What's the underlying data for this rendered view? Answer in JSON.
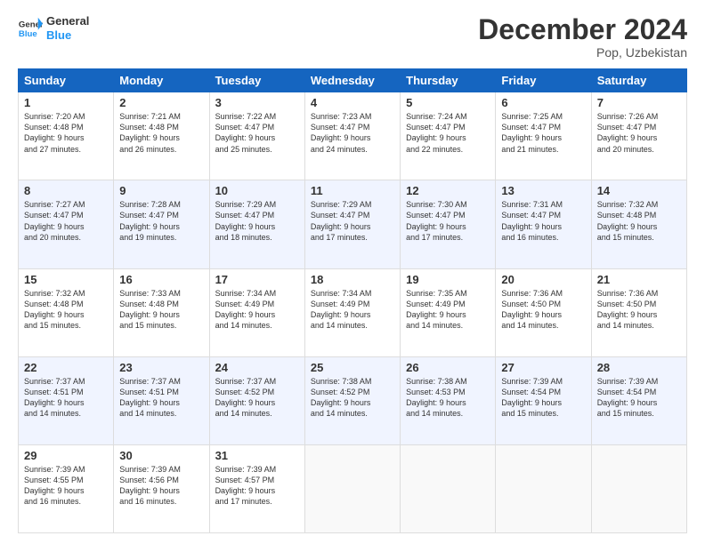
{
  "logo": {
    "general": "General",
    "blue": "Blue"
  },
  "header": {
    "month": "December 2024",
    "location": "Pop, Uzbekistan"
  },
  "weekdays": [
    "Sunday",
    "Monday",
    "Tuesday",
    "Wednesday",
    "Thursday",
    "Friday",
    "Saturday"
  ],
  "weeks": [
    [
      {
        "day": "1",
        "sunrise": "7:20 AM",
        "sunset": "4:48 PM",
        "daylight_hours": "9",
        "daylight_minutes": "27"
      },
      {
        "day": "2",
        "sunrise": "7:21 AM",
        "sunset": "4:48 PM",
        "daylight_hours": "9",
        "daylight_minutes": "26"
      },
      {
        "day": "3",
        "sunrise": "7:22 AM",
        "sunset": "4:47 PM",
        "daylight_hours": "9",
        "daylight_minutes": "25"
      },
      {
        "day": "4",
        "sunrise": "7:23 AM",
        "sunset": "4:47 PM",
        "daylight_hours": "9",
        "daylight_minutes": "24"
      },
      {
        "day": "5",
        "sunrise": "7:24 AM",
        "sunset": "4:47 PM",
        "daylight_hours": "9",
        "daylight_minutes": "22"
      },
      {
        "day": "6",
        "sunrise": "7:25 AM",
        "sunset": "4:47 PM",
        "daylight_hours": "9",
        "daylight_minutes": "21"
      },
      {
        "day": "7",
        "sunrise": "7:26 AM",
        "sunset": "4:47 PM",
        "daylight_hours": "9",
        "daylight_minutes": "20"
      }
    ],
    [
      {
        "day": "8",
        "sunrise": "7:27 AM",
        "sunset": "4:47 PM",
        "daylight_hours": "9",
        "daylight_minutes": "20"
      },
      {
        "day": "9",
        "sunrise": "7:28 AM",
        "sunset": "4:47 PM",
        "daylight_hours": "9",
        "daylight_minutes": "19"
      },
      {
        "day": "10",
        "sunrise": "7:29 AM",
        "sunset": "4:47 PM",
        "daylight_hours": "9",
        "daylight_minutes": "18"
      },
      {
        "day": "11",
        "sunrise": "7:29 AM",
        "sunset": "4:47 PM",
        "daylight_hours": "9",
        "daylight_minutes": "17"
      },
      {
        "day": "12",
        "sunrise": "7:30 AM",
        "sunset": "4:47 PM",
        "daylight_hours": "9",
        "daylight_minutes": "17"
      },
      {
        "day": "13",
        "sunrise": "7:31 AM",
        "sunset": "4:47 PM",
        "daylight_hours": "9",
        "daylight_minutes": "16"
      },
      {
        "day": "14",
        "sunrise": "7:32 AM",
        "sunset": "4:48 PM",
        "daylight_hours": "9",
        "daylight_minutes": "15"
      }
    ],
    [
      {
        "day": "15",
        "sunrise": "7:32 AM",
        "sunset": "4:48 PM",
        "daylight_hours": "9",
        "daylight_minutes": "15"
      },
      {
        "day": "16",
        "sunrise": "7:33 AM",
        "sunset": "4:48 PM",
        "daylight_hours": "9",
        "daylight_minutes": "15"
      },
      {
        "day": "17",
        "sunrise": "7:34 AM",
        "sunset": "4:49 PM",
        "daylight_hours": "9",
        "daylight_minutes": "14"
      },
      {
        "day": "18",
        "sunrise": "7:34 AM",
        "sunset": "4:49 PM",
        "daylight_hours": "9",
        "daylight_minutes": "14"
      },
      {
        "day": "19",
        "sunrise": "7:35 AM",
        "sunset": "4:49 PM",
        "daylight_hours": "9",
        "daylight_minutes": "14"
      },
      {
        "day": "20",
        "sunrise": "7:36 AM",
        "sunset": "4:50 PM",
        "daylight_hours": "9",
        "daylight_minutes": "14"
      },
      {
        "day": "21",
        "sunrise": "7:36 AM",
        "sunset": "4:50 PM",
        "daylight_hours": "9",
        "daylight_minutes": "14"
      }
    ],
    [
      {
        "day": "22",
        "sunrise": "7:37 AM",
        "sunset": "4:51 PM",
        "daylight_hours": "9",
        "daylight_minutes": "14"
      },
      {
        "day": "23",
        "sunrise": "7:37 AM",
        "sunset": "4:51 PM",
        "daylight_hours": "9",
        "daylight_minutes": "14"
      },
      {
        "day": "24",
        "sunrise": "7:37 AM",
        "sunset": "4:52 PM",
        "daylight_hours": "9",
        "daylight_minutes": "14"
      },
      {
        "day": "25",
        "sunrise": "7:38 AM",
        "sunset": "4:52 PM",
        "daylight_hours": "9",
        "daylight_minutes": "14"
      },
      {
        "day": "26",
        "sunrise": "7:38 AM",
        "sunset": "4:53 PM",
        "daylight_hours": "9",
        "daylight_minutes": "14"
      },
      {
        "day": "27",
        "sunrise": "7:39 AM",
        "sunset": "4:54 PM",
        "daylight_hours": "9",
        "daylight_minutes": "15"
      },
      {
        "day": "28",
        "sunrise": "7:39 AM",
        "sunset": "4:54 PM",
        "daylight_hours": "9",
        "daylight_minutes": "15"
      }
    ],
    [
      {
        "day": "29",
        "sunrise": "7:39 AM",
        "sunset": "4:55 PM",
        "daylight_hours": "9",
        "daylight_minutes": "16"
      },
      {
        "day": "30",
        "sunrise": "7:39 AM",
        "sunset": "4:56 PM",
        "daylight_hours": "9",
        "daylight_minutes": "16"
      },
      {
        "day": "31",
        "sunrise": "7:39 AM",
        "sunset": "4:57 PM",
        "daylight_hours": "9",
        "daylight_minutes": "17"
      },
      null,
      null,
      null,
      null
    ]
  ]
}
